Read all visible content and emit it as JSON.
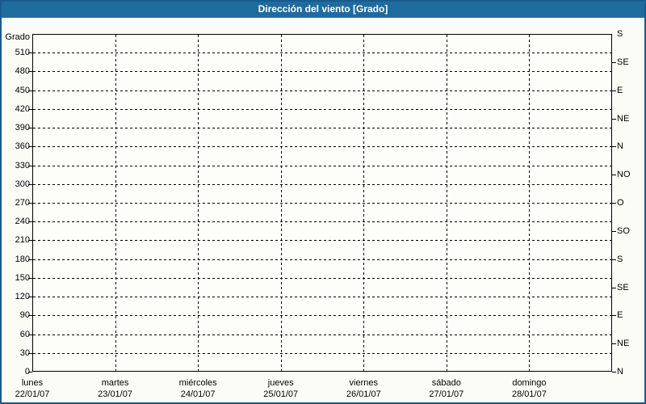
{
  "window": {
    "title": "Dirección del viento [Grado]"
  },
  "colors": {
    "titlebar_bg": "#1f6b9e",
    "outer_border": "#1a5a8c",
    "title_text": "#ffffff",
    "plot_bg": "#fdfdf9",
    "grid": "#000000",
    "axis_text": "#000000"
  },
  "chart_data": {
    "type": "line",
    "title": "Dirección del viento [Grado]",
    "xlabel": "",
    "ylabel": "Grado",
    "ylim": [
      0,
      540
    ],
    "y_tick_interval": 30,
    "grid": true,
    "legend_position": "none",
    "y_ticks": [
      0,
      30,
      60,
      90,
      120,
      150,
      180,
      210,
      240,
      270,
      300,
      330,
      360,
      390,
      420,
      450,
      480,
      510
    ],
    "right_axis_ticks": [
      {
        "deg": 0,
        "label": "N"
      },
      {
        "deg": 45,
        "label": "NE"
      },
      {
        "deg": 90,
        "label": "E"
      },
      {
        "deg": 135,
        "label": "SE"
      },
      {
        "deg": 180,
        "label": "S"
      },
      {
        "deg": 225,
        "label": "SO"
      },
      {
        "deg": 270,
        "label": "O"
      },
      {
        "deg": 315,
        "label": "NO"
      },
      {
        "deg": 360,
        "label": "N"
      },
      {
        "deg": 405,
        "label": "NE"
      },
      {
        "deg": 450,
        "label": "E"
      },
      {
        "deg": 495,
        "label": "SE"
      },
      {
        "deg": 540,
        "label": "S"
      }
    ],
    "x_categories": [
      {
        "day": "lunes",
        "date": "22/01/07"
      },
      {
        "day": "martes",
        "date": "23/01/07"
      },
      {
        "day": "miércoles",
        "date": "24/01/07"
      },
      {
        "day": "jueves",
        "date": "25/01/07"
      },
      {
        "day": "viernes",
        "date": "26/01/07"
      },
      {
        "day": "sábado",
        "date": "27/01/07"
      },
      {
        "day": "domingo",
        "date": "28/01/07"
      }
    ],
    "series": []
  }
}
